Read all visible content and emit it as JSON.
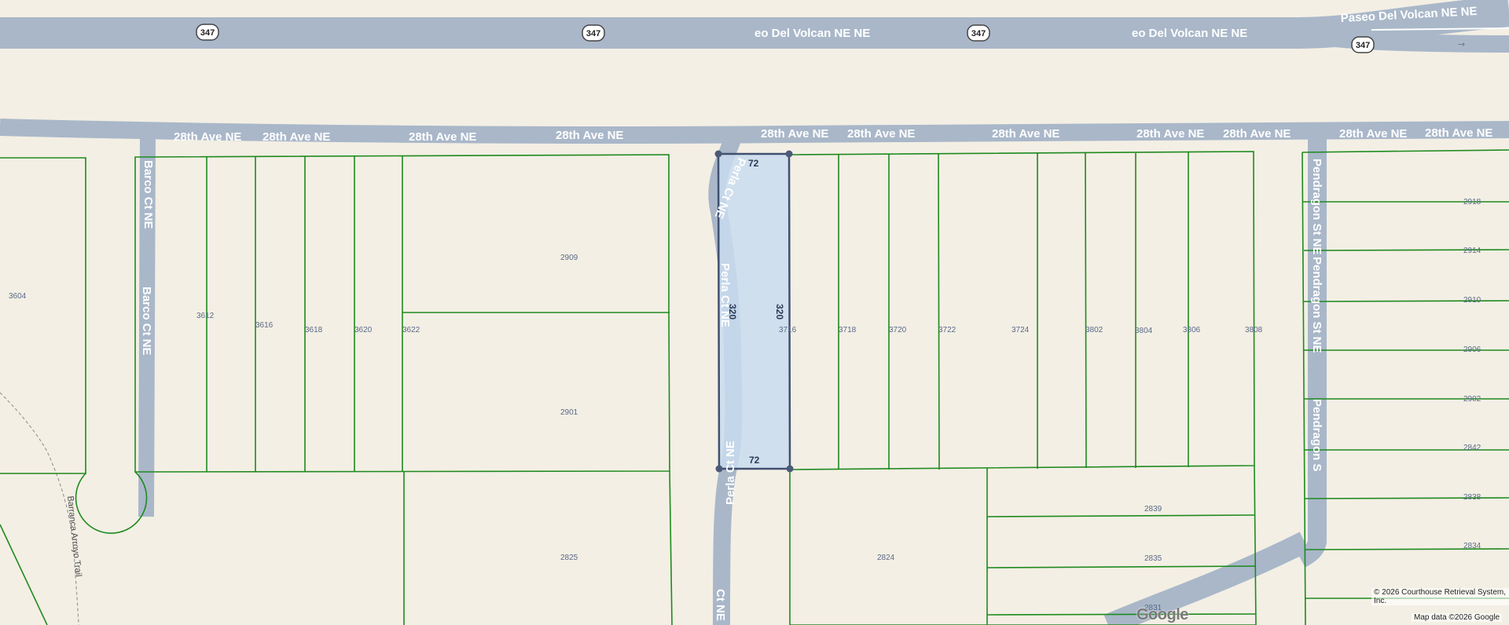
{
  "roads": {
    "paseo_labels": [
      "eo Del Volcan NE NE",
      "eo Del Volcan NE NE",
      "Paseo Del Volcan NE NE"
    ],
    "route_shields": [
      "347",
      "347",
      "347",
      "347"
    ],
    "ave28_labels": [
      "28th Ave NE",
      "28th Ave NE",
      "28th Ave NE",
      "28th Ave NE",
      "28th Ave NE",
      "28th Ave NE",
      "28th Ave NE",
      "28th Ave NE",
      "28th Ave NE",
      "28th Ave NE",
      "28th Ave NE"
    ],
    "barco_labels": [
      "Barco Ct NE",
      "Barco Ct NE"
    ],
    "perla_labels": [
      "Perla Ct NE",
      "Perla Ct NE",
      "Perla Ct NE",
      "Ct NE"
    ],
    "pendragon_labels": [
      "Pendragon St NE",
      "Pendragon St NE",
      "Pendragon S"
    ],
    "trail_label": "Barranca Arroyo Trail"
  },
  "lots": {
    "north_row": [
      "3604",
      "3612",
      "3616",
      "3618",
      "3620",
      "3622",
      "3716",
      "3718",
      "3720",
      "3722",
      "3724",
      "3802",
      "3804",
      "3806",
      "3808"
    ],
    "large": [
      "2909",
      "2901",
      "2825",
      "2824",
      "2839",
      "2835",
      "2831"
    ],
    "east_side": [
      "2918",
      "2914",
      "2910",
      "2906",
      "2902",
      "2842",
      "2838",
      "2834"
    ]
  },
  "selected_parcel": {
    "width_top": "72",
    "width_bottom": "72",
    "depth_left": "320",
    "depth_right": "320"
  },
  "attribution": {
    "courthouse": "© 2026 Courthouse Retrieval System, Inc.",
    "map_data": "Map data ©2026 Google",
    "logo": "Google"
  },
  "colors": {
    "background": "#f3efe4",
    "road": "#a9b7c9",
    "parcel_line": "#1f8a1f",
    "selected_fill": "#c9dcef",
    "selected_stroke": "#3f5070"
  }
}
